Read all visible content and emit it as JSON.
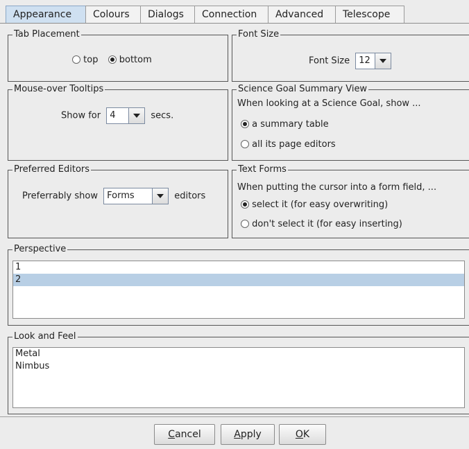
{
  "tabs": [
    {
      "label": "Appearance",
      "active": true
    },
    {
      "label": "Colours",
      "active": false
    },
    {
      "label": "Dialogs",
      "active": false
    },
    {
      "label": "Connection",
      "active": false
    },
    {
      "label": "Advanced",
      "active": false
    },
    {
      "label": "Telescope",
      "active": false
    }
  ],
  "tab_placement": {
    "title": "Tab Placement",
    "options": [
      {
        "label": "top",
        "selected": false
      },
      {
        "label": "bottom",
        "selected": true
      }
    ]
  },
  "font_size": {
    "title": "Font Size",
    "label": "Font Size",
    "value": "12"
  },
  "tooltips": {
    "title": "Mouse-over Tooltips",
    "prefix": "Show for",
    "value": "4",
    "suffix": "secs."
  },
  "science_goal": {
    "title": "Science Goal Summary View",
    "prompt": "When looking at a Science Goal, show ...",
    "options": [
      {
        "label": "a summary table",
        "selected": true
      },
      {
        "label": "all its page editors",
        "selected": false
      }
    ]
  },
  "preferred_editors": {
    "title": "Preferred Editors",
    "prefix": "Preferrably show",
    "value": "Forms",
    "suffix": "editors"
  },
  "text_forms": {
    "title": "Text Forms",
    "prompt": "When putting the cursor into a form field, ...",
    "options": [
      {
        "label": "select it (for easy overwriting)",
        "selected": true
      },
      {
        "label": "don't select it (for easy inserting)",
        "selected": false
      }
    ]
  },
  "perspective": {
    "title": "Perspective",
    "items": [
      {
        "label": "1",
        "selected": false
      },
      {
        "label": "2",
        "selected": true
      }
    ]
  },
  "look_and_feel": {
    "title": "Look and Feel",
    "items": [
      {
        "label": "Metal"
      },
      {
        "label": "Nimbus"
      }
    ]
  },
  "buttons": {
    "cancel_mnemonic": "C",
    "cancel_rest": "ancel",
    "apply_mnemonic": "A",
    "apply_rest": "pply",
    "ok_mnemonic": "O",
    "ok_rest": "K"
  },
  "colors": {
    "active_tab": "#cfe0f1",
    "list_selection": "#b8cfe5"
  }
}
